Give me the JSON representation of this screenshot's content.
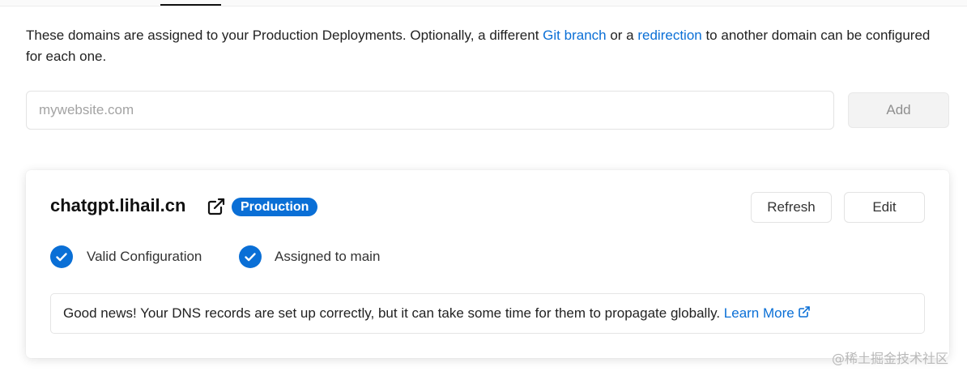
{
  "intro": {
    "text_1": "These domains are assigned to your Production Deployments. Optionally, a different ",
    "link_git_branch": "Git branch",
    "text_2": " or a ",
    "link_redirection": "redirection",
    "text_3": " to another domain can be configured for each one."
  },
  "add_domain": {
    "placeholder": "mywebsite.com",
    "value": "",
    "add_label": "Add"
  },
  "domain_card": {
    "domain": "chatgpt.lihail.cn",
    "badge": "Production",
    "refresh_label": "Refresh",
    "edit_label": "Edit",
    "status_items": [
      {
        "label": "Valid Configuration",
        "icon": "check-circle-icon"
      },
      {
        "label": "Assigned to main",
        "icon": "check-circle-icon"
      }
    ],
    "notice_text": "Good news! Your DNS records are set up correctly, but it can take some time for them to propagate globally. ",
    "notice_link": "Learn More"
  },
  "watermark": "@稀土掘金技术社区",
  "colors": {
    "accent": "#0a6fd6",
    "text": "#111111",
    "border": "#e3e3e3",
    "muted": "#a3a3a3"
  }
}
